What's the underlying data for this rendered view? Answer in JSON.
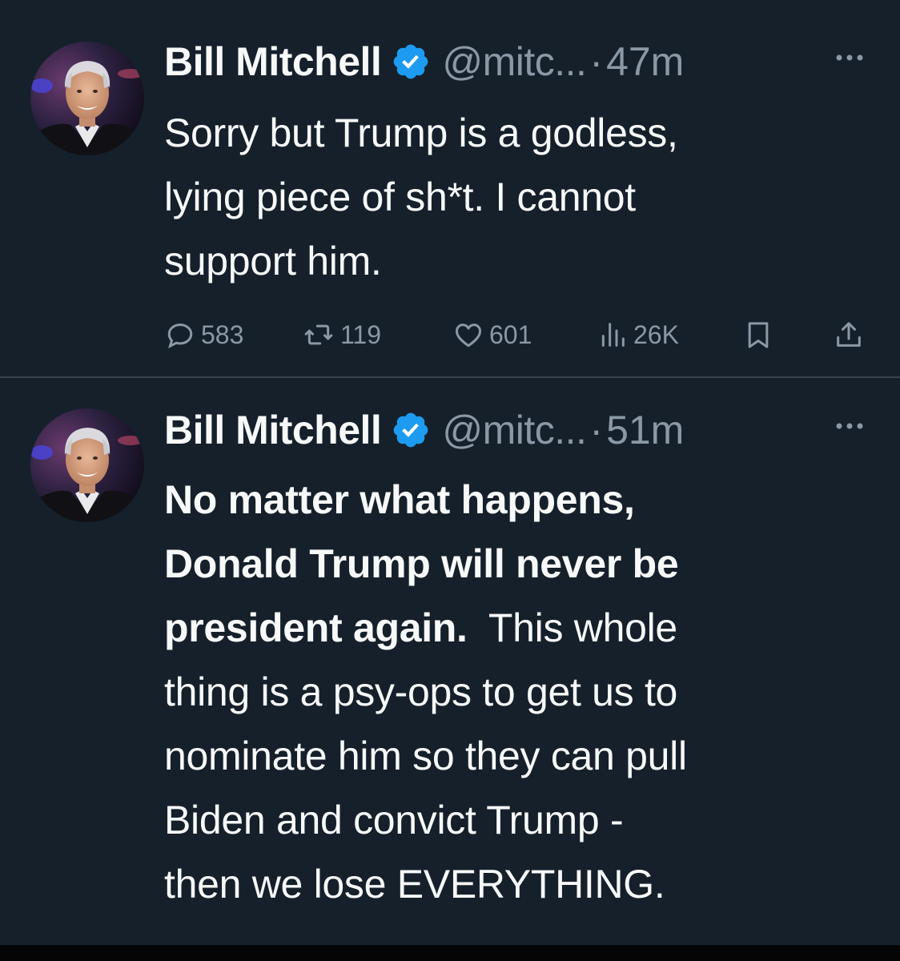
{
  "tweets": [
    {
      "author": {
        "name": "Bill Mitchell",
        "verified": true,
        "verified_color": "#1d9bf0",
        "handle": "@mitc...",
        "time": "47m",
        "avatar": "profile-photo"
      },
      "text_lines": [
        "Sorry but Trump is a godless,",
        "lying piece of sh*t.  I cannot",
        "support him."
      ],
      "metrics": {
        "replies": "583",
        "retweets": "119",
        "likes": "601",
        "views": "26K"
      },
      "icons": [
        "reply-icon",
        "retweet-icon",
        "like-icon",
        "views-icon",
        "bookmark-icon",
        "share-icon",
        "more-icon"
      ]
    },
    {
      "author": {
        "name": "Bill Mitchell",
        "verified": true,
        "verified_color": "#1d9bf0",
        "handle": "@mitc...",
        "time": "51m",
        "avatar": "profile-photo"
      },
      "text": {
        "line1": "No matter what happens,",
        "line2": "Donald Trump will never be",
        "line3_bold": "president again.",
        "line3_rest": "  This whole",
        "line4": "thing is a psy-ops to get us to",
        "line5": "nominate him so they can pull",
        "line6": "Biden and convict Trump -",
        "line7": "then we lose EVERYTHING."
      }
    }
  ],
  "dot_separator": "·",
  "colors": {
    "background": "#15202b",
    "text_primary": "#f7f9f9",
    "text_secondary": "#8b98a5",
    "divider": "#38444d",
    "verified": "#1d9bf0"
  }
}
